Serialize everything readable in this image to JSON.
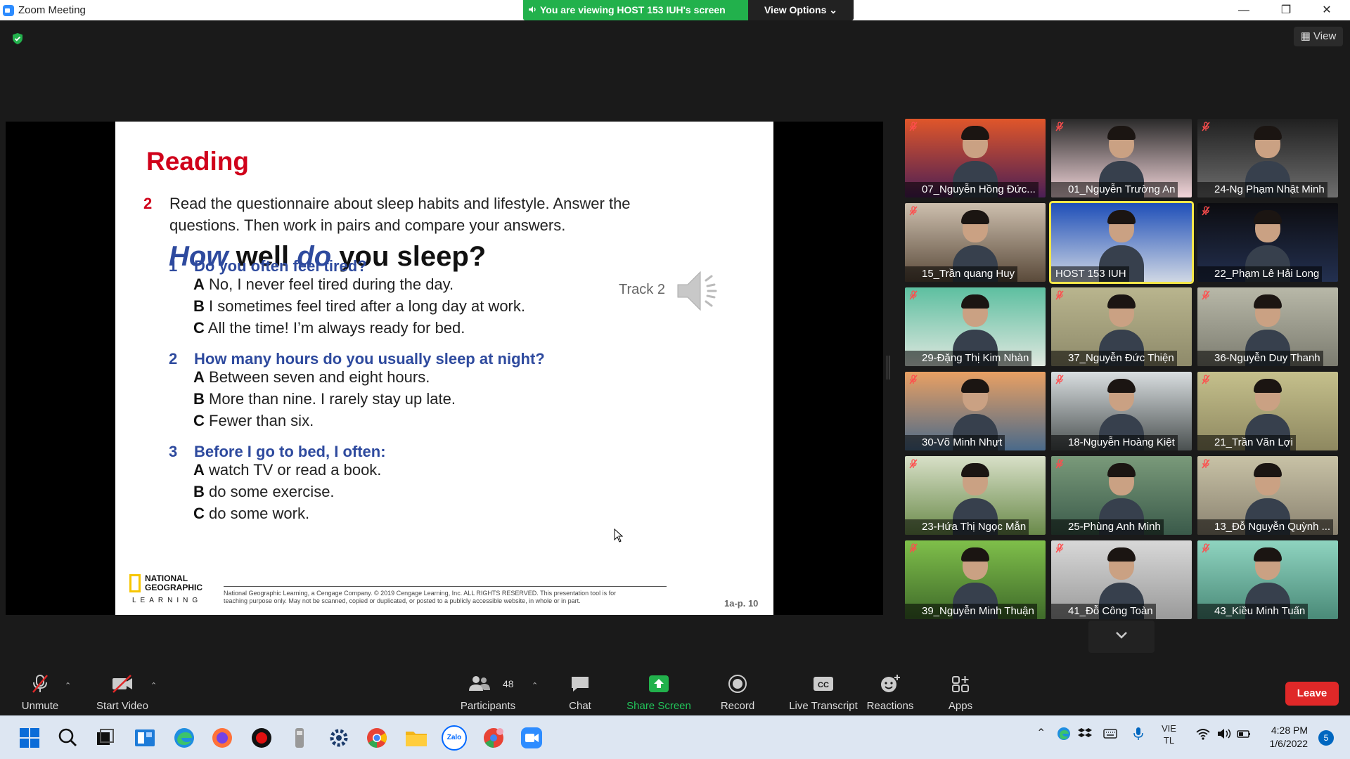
{
  "window": {
    "title": "Zoom Meeting",
    "banner": "You are viewing HOST 153 IUH's screen",
    "view_options": "View Options",
    "view_label": "View"
  },
  "slide": {
    "title": "Reading",
    "exercise_number": "2",
    "instruction_line1": "Read the questionnaire about sleep habits and lifestyle.  Answer the",
    "instruction_line2": "questions. Then work in pairs and compare your answers.",
    "heading": {
      "w1": "How",
      "w2": "well",
      "w3": "do",
      "w4": "you sleep?"
    },
    "track": "Track 2",
    "questions": [
      {
        "num": "1",
        "text": "Do you often feel tired?",
        "answers": [
          {
            "letter": "A",
            "text": "No, I never feel tired during the day."
          },
          {
            "letter": "B",
            "text": "I sometimes feel tired after a long day at work."
          },
          {
            "letter": "C",
            "text": "All the time! I’m always ready for bed."
          }
        ]
      },
      {
        "num": "2",
        "text": "How many hours do you usually sleep at night?",
        "answers": [
          {
            "letter": "A",
            "text": "Between seven and eight hours."
          },
          {
            "letter": "B",
            "text": "More than nine. I rarely stay up late."
          },
          {
            "letter": "C",
            "text": "Fewer than six."
          }
        ]
      },
      {
        "num": "3",
        "text": "Before I go to bed, I often:",
        "answers": [
          {
            "letter": "A",
            "text": "watch TV or read a book."
          },
          {
            "letter": "B",
            "text": "do some exercise."
          },
          {
            "letter": "C",
            "text": "do some work."
          }
        ]
      }
    ],
    "logo_line1": "NATIONAL",
    "logo_line2": "GEOGRAPHIC",
    "logo_line3": "LEARNING",
    "copyright_line1": "National Geographic Learning, a Cengage Company. © 2019 Cengage Learning, Inc. ALL RIGHTS RESERVED. This presentation tool is for",
    "copyright_line2": "teaching purpose only. May not be scanned, copied or duplicated, or posted to a publicly accessible website, in whole or in part.",
    "page_ref": "1a-p. 10"
  },
  "participants": [
    {
      "name": "07_Nguyễn Hồng Đức...",
      "bg": "#e0562a",
      "bg2": "#4b1f55"
    },
    {
      "name": "01_Nguyễn Trường An",
      "bg": "#2a2a2a",
      "bg2": "#f3d6da"
    },
    {
      "name": "24-Ng Phạm Nhật Minh",
      "bg": "#202020",
      "bg2": "#6e6e6e"
    },
    {
      "name": "15_Trần quang Huy",
      "bg": "#cdbfae",
      "bg2": "#5a4a3a"
    },
    {
      "name": "HOST 153 IUH",
      "bg": "#1f4fb8",
      "bg2": "#cfd7e4"
    },
    {
      "name": "22_Phạm Lê Hải Long",
      "bg": "#0c0c10",
      "bg2": "#233050"
    },
    {
      "name": "29-Đặng Thị Kim Nhàn",
      "bg": "#5dbfa0",
      "bg2": "#dfe7df"
    },
    {
      "name": "37_Nguyễn Đức Thiện",
      "bg": "#b9b58e",
      "bg2": "#8e8a6a"
    },
    {
      "name": "36-Nguyễn Duy Thanh",
      "bg": "#b8b8a8",
      "bg2": "#7c7c70"
    },
    {
      "name": "30-Võ Minh Nhựt",
      "bg": "#e9a063",
      "bg2": "#4a6a8a"
    },
    {
      "name": "18-Nguyễn Hoàng Kiệt",
      "bg": "#d9dee0",
      "bg2": "#4a5050"
    },
    {
      "name": "21_Trần Văn Lợi",
      "bg": "#c5c08c",
      "bg2": "#8e8860"
    },
    {
      "name": "23-Hứa Thị Ngọc Mẫn",
      "bg": "#d8e0c8",
      "bg2": "#6a8a4a"
    },
    {
      "name": "25-Phùng Anh Minh",
      "bg": "#7a9a7a",
      "bg2": "#3a5a4a"
    },
    {
      "name": "13_Đỗ Nguyễn Quỳnh ...",
      "bg": "#c8c2a6",
      "bg2": "#8a8270"
    },
    {
      "name": "39_Nguyễn Minh Thuận",
      "bg": "#7fbf4a",
      "bg2": "#3f6a2a"
    },
    {
      "name": "41_Đỗ Công Toàn",
      "bg": "#d8d8d8",
      "bg2": "#9a9a9a"
    },
    {
      "name": "43_Kiều Minh Tuấn",
      "bg": "#8fd4c0",
      "bg2": "#4a8a78"
    }
  ],
  "toolbar": {
    "unmute": "Unmute",
    "start_video": "Start Video",
    "participants": "Participants",
    "participants_count": "48",
    "chat": "Chat",
    "share_screen": "Share Screen",
    "record": "Record",
    "live_transcript": "Live Transcript",
    "reactions": "Reactions",
    "apps": "Apps",
    "leave": "Leave"
  },
  "taskbar": {
    "language_line1": "VIE",
    "language_line2": "TL",
    "time": "4:28 PM",
    "date": "1/6/2022",
    "notifications": "5",
    "zalo_label": "Zalo"
  },
  "colors": {
    "accent": "#2d8cff",
    "share_green": "#22b14c",
    "leave_red": "#e02828",
    "slide_red": "#d0021b",
    "slide_blue": "#2e4a9e"
  }
}
